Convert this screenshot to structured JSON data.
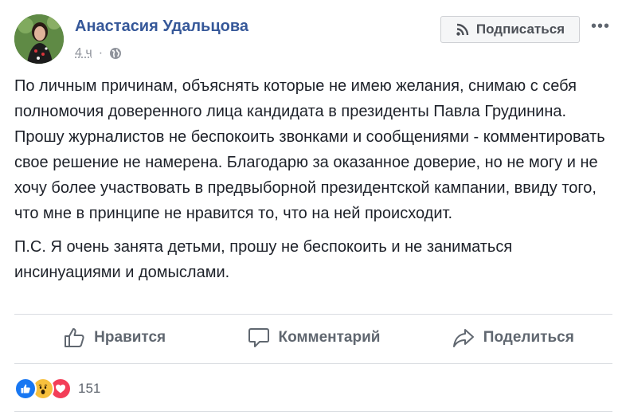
{
  "post": {
    "author": "Анастасия Удальцова",
    "time": "4 ч",
    "privacy_icon": "globe-icon",
    "subscribe_label": "Подписаться",
    "subscribe_icon": "rss-icon",
    "more_label": "•••",
    "paragraphs": [
      "По личным причинам, объяснять которые не имею желания, снимаю с себя полномочия доверенного лица кандидата в президенты Павла Грудинина. Прошу журналистов не беспокоить звонками и сообщениями - комментировать свое решение не намерена. Благодарю за оказанное доверие, но не могу и не хочу более участвовать в предвыборной президентской кампании, ввиду того, что мне в принципе не нравится то, что на ней происходит.",
      "П.С. Я очень занята детьми, прошу не беспокоить и не заниматься инсинуациями и домыслами."
    ]
  },
  "actions": {
    "like_label": "Нравится",
    "comment_label": "Комментарий",
    "share_label": "Поделиться"
  },
  "reactions": {
    "types": [
      "like",
      "wow",
      "love"
    ],
    "count": "151"
  },
  "colors": {
    "author": "#365899",
    "like": "#1877f2",
    "wow": "#f7c03d",
    "love": "#f33e58"
  }
}
